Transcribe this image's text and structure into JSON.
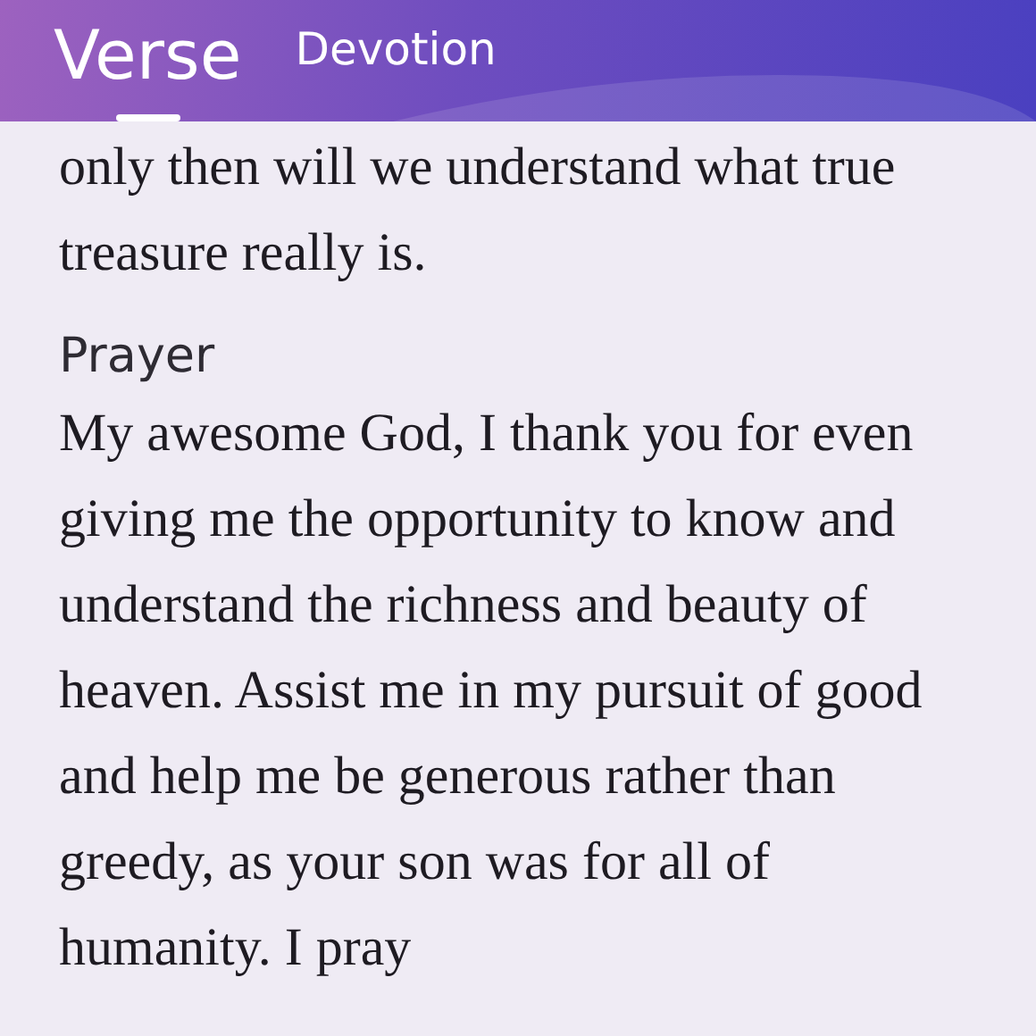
{
  "tabs": [
    {
      "label": "Verse",
      "selected": true
    },
    {
      "label": "Devotion",
      "selected": false
    }
  ],
  "sections": [
    {
      "kind": "text",
      "text": "only then will we understand what true treasure really is."
    },
    {
      "kind": "heading",
      "text": "Prayer"
    },
    {
      "kind": "text",
      "text": "My awesome God, I thank you for even giving me the opportunity to know and understand the richness and beauty of heaven. Assist me in my pursuit of good and help me be generous rather than greedy, as your son was for all of humanity. I pray"
    }
  ]
}
